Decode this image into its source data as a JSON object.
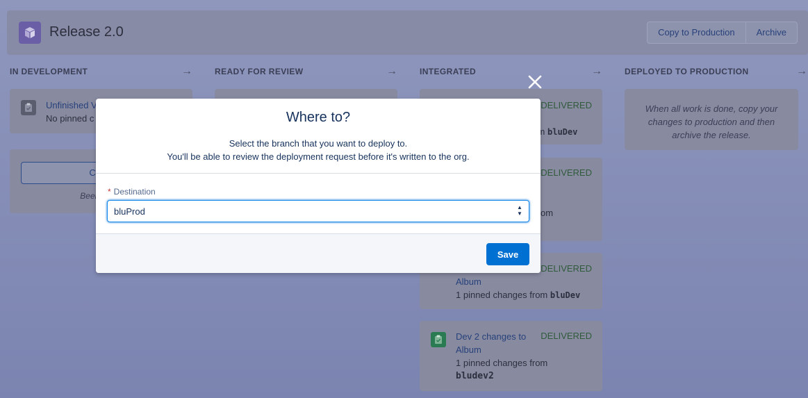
{
  "header": {
    "title": "Release 2.0",
    "copy_label": "Copy to Production",
    "archive_label": "Archive"
  },
  "columns": [
    {
      "title": "IN DEVELOPMENT"
    },
    {
      "title": "READY FOR REVIEW"
    },
    {
      "title": "INTEGRATED"
    },
    {
      "title": "DEPLOYED TO PRODUCTION"
    }
  ],
  "in_development": {
    "card_title": "Unfinished V",
    "card_sub": "No pinned c",
    "create_label": "Create V",
    "busy_text": "Been busy? Pi"
  },
  "integrated_cards": [
    {
      "status": "DELIVERED",
      "sub_prefix": "rom ",
      "branch": "bluDev"
    },
    {
      "status": "DELIVERED",
      "sub_prefix": "om"
    },
    {
      "status": "DELIVERED",
      "title": "Album",
      "sub": "1 pinned changes from ",
      "branch": "bluDev"
    },
    {
      "status": "DELIVERED",
      "title_line1": "Dev 2 changes to",
      "title_line2": "Album",
      "sub": "1 pinned changes from",
      "branch": "bludev2"
    }
  ],
  "deployed": {
    "hint": "When all work is done, copy your changes to production and then archive the release."
  },
  "modal": {
    "title": "Where to?",
    "desc_line1": "Select the branch that you want to deploy to.",
    "desc_line2": "You'll be able to review the deployment request before it's written to the org.",
    "required_marker": "*",
    "field_label": "Destination",
    "selected_value": "bluProd",
    "save_label": "Save"
  },
  "colors": {
    "primary": "#0070d2",
    "delivered": "#04844b",
    "link": "#0070d2",
    "text": "#16325c"
  }
}
